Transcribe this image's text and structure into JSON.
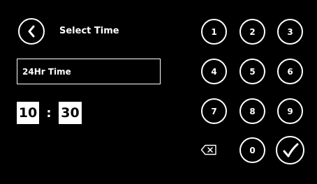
{
  "header": {
    "back_icon": "chevron-left-icon",
    "title": "Select Time"
  },
  "time_format": {
    "label": "24Hr Time"
  },
  "time": {
    "hours": "10",
    "separator": ":",
    "minutes": "30"
  },
  "keypad": {
    "keys": [
      "1",
      "2",
      "3",
      "4",
      "5",
      "6",
      "7",
      "8",
      "9",
      "0"
    ],
    "backspace_icon": "backspace-icon",
    "confirm_icon": "checkmark-icon"
  },
  "colors": {
    "background": "#000000",
    "foreground": "#ffffff"
  }
}
